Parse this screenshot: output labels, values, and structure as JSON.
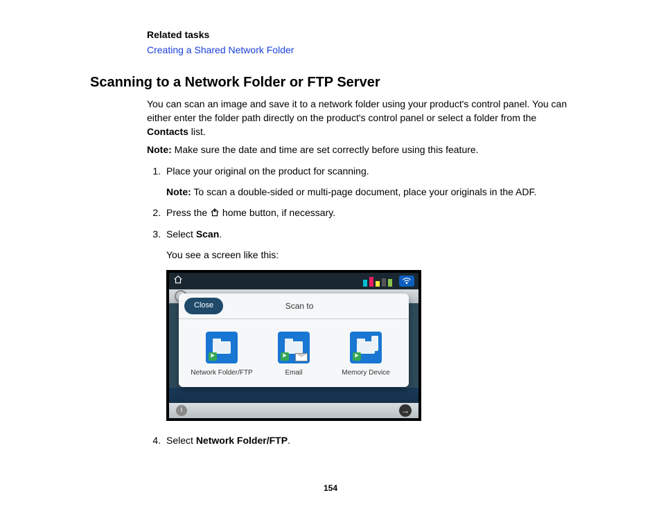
{
  "relatedTasks": {
    "heading": "Related tasks",
    "link": "Creating a Shared Network Folder"
  },
  "section": {
    "title": "Scanning to a Network Folder or FTP Server",
    "intro_a": "You can scan an image and save it to a network folder using your product's control panel. You can either enter the folder path directly on the product's control panel or select a folder from the ",
    "intro_bold": "Contacts",
    "intro_b": " list.",
    "note_prefix": "Note:",
    "note_text": " Make sure the date and time are set correctly before using this feature."
  },
  "steps": {
    "s1": "Place your original on the product for scanning.",
    "s1_note_prefix": "Note:",
    "s1_note_text": " To scan a double-sided or multi-page document, place your originals in the ADF.",
    "s2_a": "Press the ",
    "s2_b": " home button, if necessary.",
    "s3_a": "Select ",
    "s3_bold": "Scan",
    "s3_b": ".",
    "s3_after": "You see a screen like this:",
    "s4_a": "Select ",
    "s4_bold": "Network Folder/FTP",
    "s4_b": "."
  },
  "modal": {
    "close": "Close",
    "title": "Scan to",
    "opt1": "Network Folder/FTP",
    "opt2": "Email",
    "opt3": "Memory Device",
    "info": "i",
    "next": "→"
  },
  "pageNumber": "154"
}
